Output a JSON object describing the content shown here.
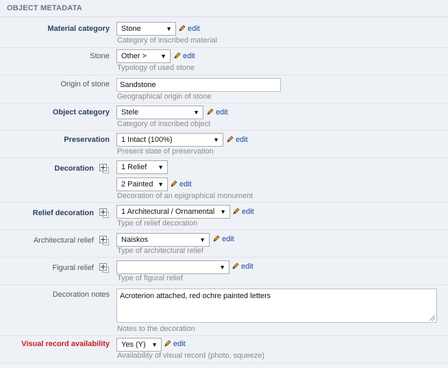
{
  "section_title": "OBJECT METADATA",
  "edit_label": "edit",
  "fields": {
    "material_category": {
      "label": "Material category",
      "value": "Stone",
      "hint": "Category of inscribed material"
    },
    "stone": {
      "label": "Stone",
      "value": "Other >",
      "hint": "Typology of used stone"
    },
    "origin_of_stone": {
      "label": "Origin of stone",
      "value": "Sandstone",
      "hint": "Geographical origin of stone"
    },
    "object_category": {
      "label": "Object category",
      "value": "Stele",
      "hint": "Category of inscribed object"
    },
    "preservation": {
      "label": "Preservation",
      "value": "1 Intact (100%)",
      "hint": "Present state of preservation"
    },
    "decoration": {
      "label": "Decoration",
      "value_1": "1 Relief",
      "value_2": "2 Painted",
      "hint": "Decoration of an epigraphical monument"
    },
    "relief_decoration": {
      "label": "Relief decoration",
      "value": "1 Architectural / Ornamental",
      "hint": "Type of relief decoration"
    },
    "architectural_relief": {
      "label": "Architectural relief",
      "value": "Naiskos",
      "hint": "Type of architectural relief"
    },
    "figural_relief": {
      "label": "Figural relief",
      "value": "",
      "hint": "Type of figural relief"
    },
    "decoration_notes": {
      "label": "Decoration notes",
      "value": "Acroterion attached, red ochre painted letters",
      "hint": "Notes to the decoration"
    },
    "visual_record": {
      "label": "Visual record availability",
      "value": "Yes (Y)",
      "hint": "Availability of visual record (photo, squeeze)"
    }
  },
  "colors": {
    "background": "#eef1f6",
    "label_bold": "#2b3f63",
    "label_required": "#c41c1c",
    "link": "#1b3fa0"
  },
  "icons": {
    "dropdown": "▼",
    "expand": "plus-box-icon",
    "edit": "pencil-icon"
  }
}
